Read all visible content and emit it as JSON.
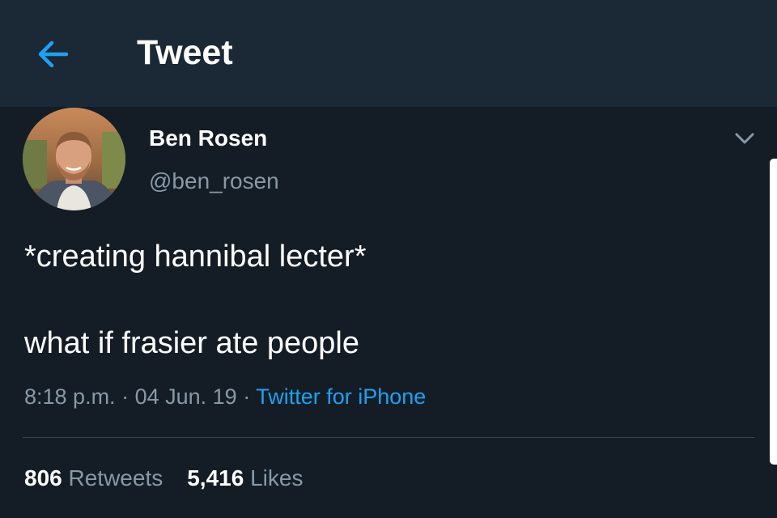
{
  "header": {
    "back_icon": "arrow-left-icon",
    "title": "Tweet"
  },
  "colors": {
    "background": "#141d26",
    "header_background": "#1b2836",
    "accent": "#1da1f2",
    "secondary_text": "#8899a6"
  },
  "tweet": {
    "author": {
      "display_name": "Ben Rosen",
      "handle": "@ben_rosen"
    },
    "menu_icon": "chevron-down-icon",
    "text_lines": [
      "*creating hannibal lecter*",
      "what if frasier ate people"
    ],
    "time": "8:18 p.m.",
    "separator": "·",
    "date": "04 Jun. 19",
    "source": "Twitter for iPhone",
    "retweets_count": "806",
    "retweets_label": "Retweets",
    "likes_count": "5,416",
    "likes_label": "Likes"
  }
}
